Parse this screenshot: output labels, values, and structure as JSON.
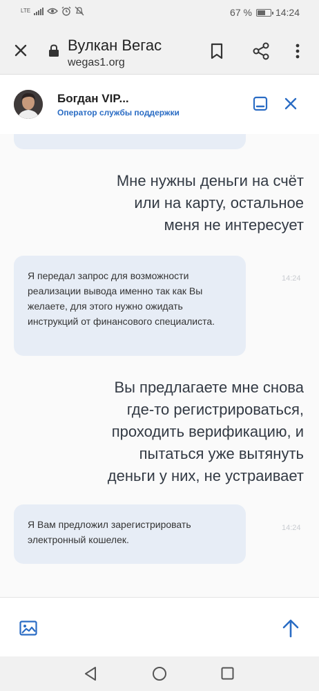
{
  "status_bar": {
    "network": "LTE",
    "battery_text": "67 %",
    "battery_level": 0.67,
    "time": "14:24"
  },
  "browser": {
    "title": "Вулкан Вегас",
    "url": "wegas1.org",
    "icons": [
      "close-icon",
      "lock-icon",
      "bookmark-icon",
      "share-icon",
      "more-icon"
    ]
  },
  "chat": {
    "agent_name": "Богдан VIP...",
    "agent_role": "Оператор службы поддержки",
    "messages": [
      {
        "from": "user",
        "lines": [
          "Мне нужны деньги на счёт",
          "или на карту, остальное",
          "меня не интересует"
        ]
      },
      {
        "from": "operator",
        "text": "Я передал запрос для возможности реализации вывода именно так как Вы желаете, для этого нужно ожидать инструкций от финансового специалиста.",
        "time": "14:24"
      },
      {
        "from": "user",
        "lines": [
          "Вы предлагаете мне снова",
          "где-то регистрироваться,",
          "проходить верификацию, и",
          "пытаться уже вытянуть",
          "деньги у них, не устраивает"
        ]
      },
      {
        "from": "operator",
        "text": "Я Вам предложил зарегистрировать электронный кошелек.",
        "time": "14:24"
      }
    ]
  },
  "colors": {
    "accent": "#2a6cc4",
    "operator_bubble": "#e7edf6",
    "user_text": "#333a44"
  }
}
